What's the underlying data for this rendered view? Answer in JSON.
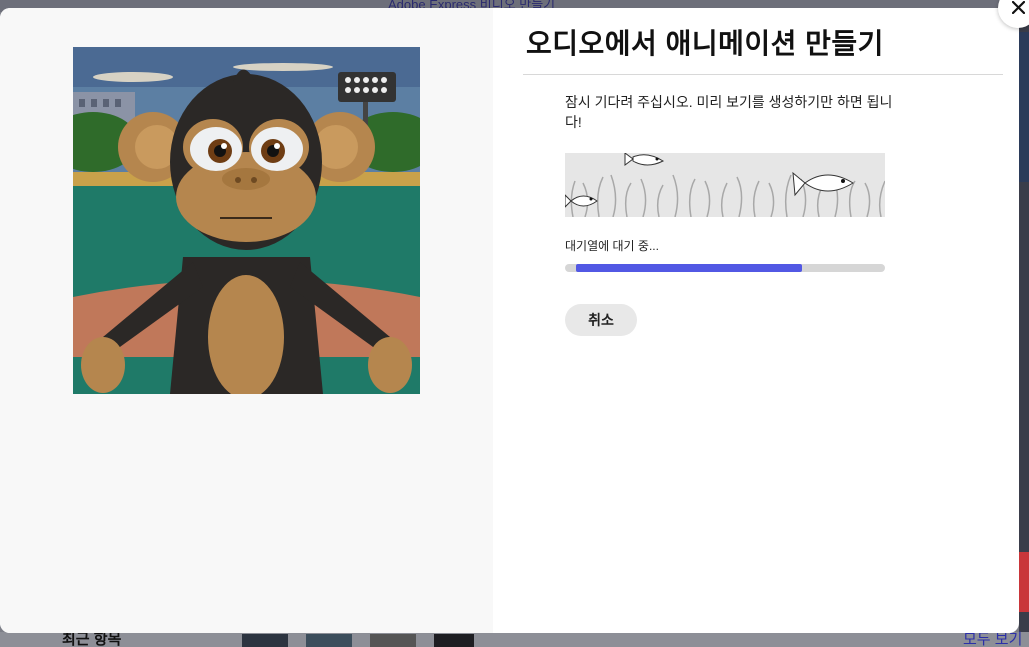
{
  "background": {
    "banner_text": "Adobe Express 비디오 만들기",
    "recent_label": "최근 항목",
    "view_all_label": "모두 보기"
  },
  "modal": {
    "title": "오디오에서 애니메이션 만들기",
    "wait_message": "잠시 기다려 주십시오. 미리 보기를 생성하기만 하면 됩니다!",
    "queue_label": "대기열에 대기 중...",
    "progress": 0.73,
    "cancel_label": "취소",
    "close_icon": "close-icon",
    "accent_color": "#5258e4"
  }
}
